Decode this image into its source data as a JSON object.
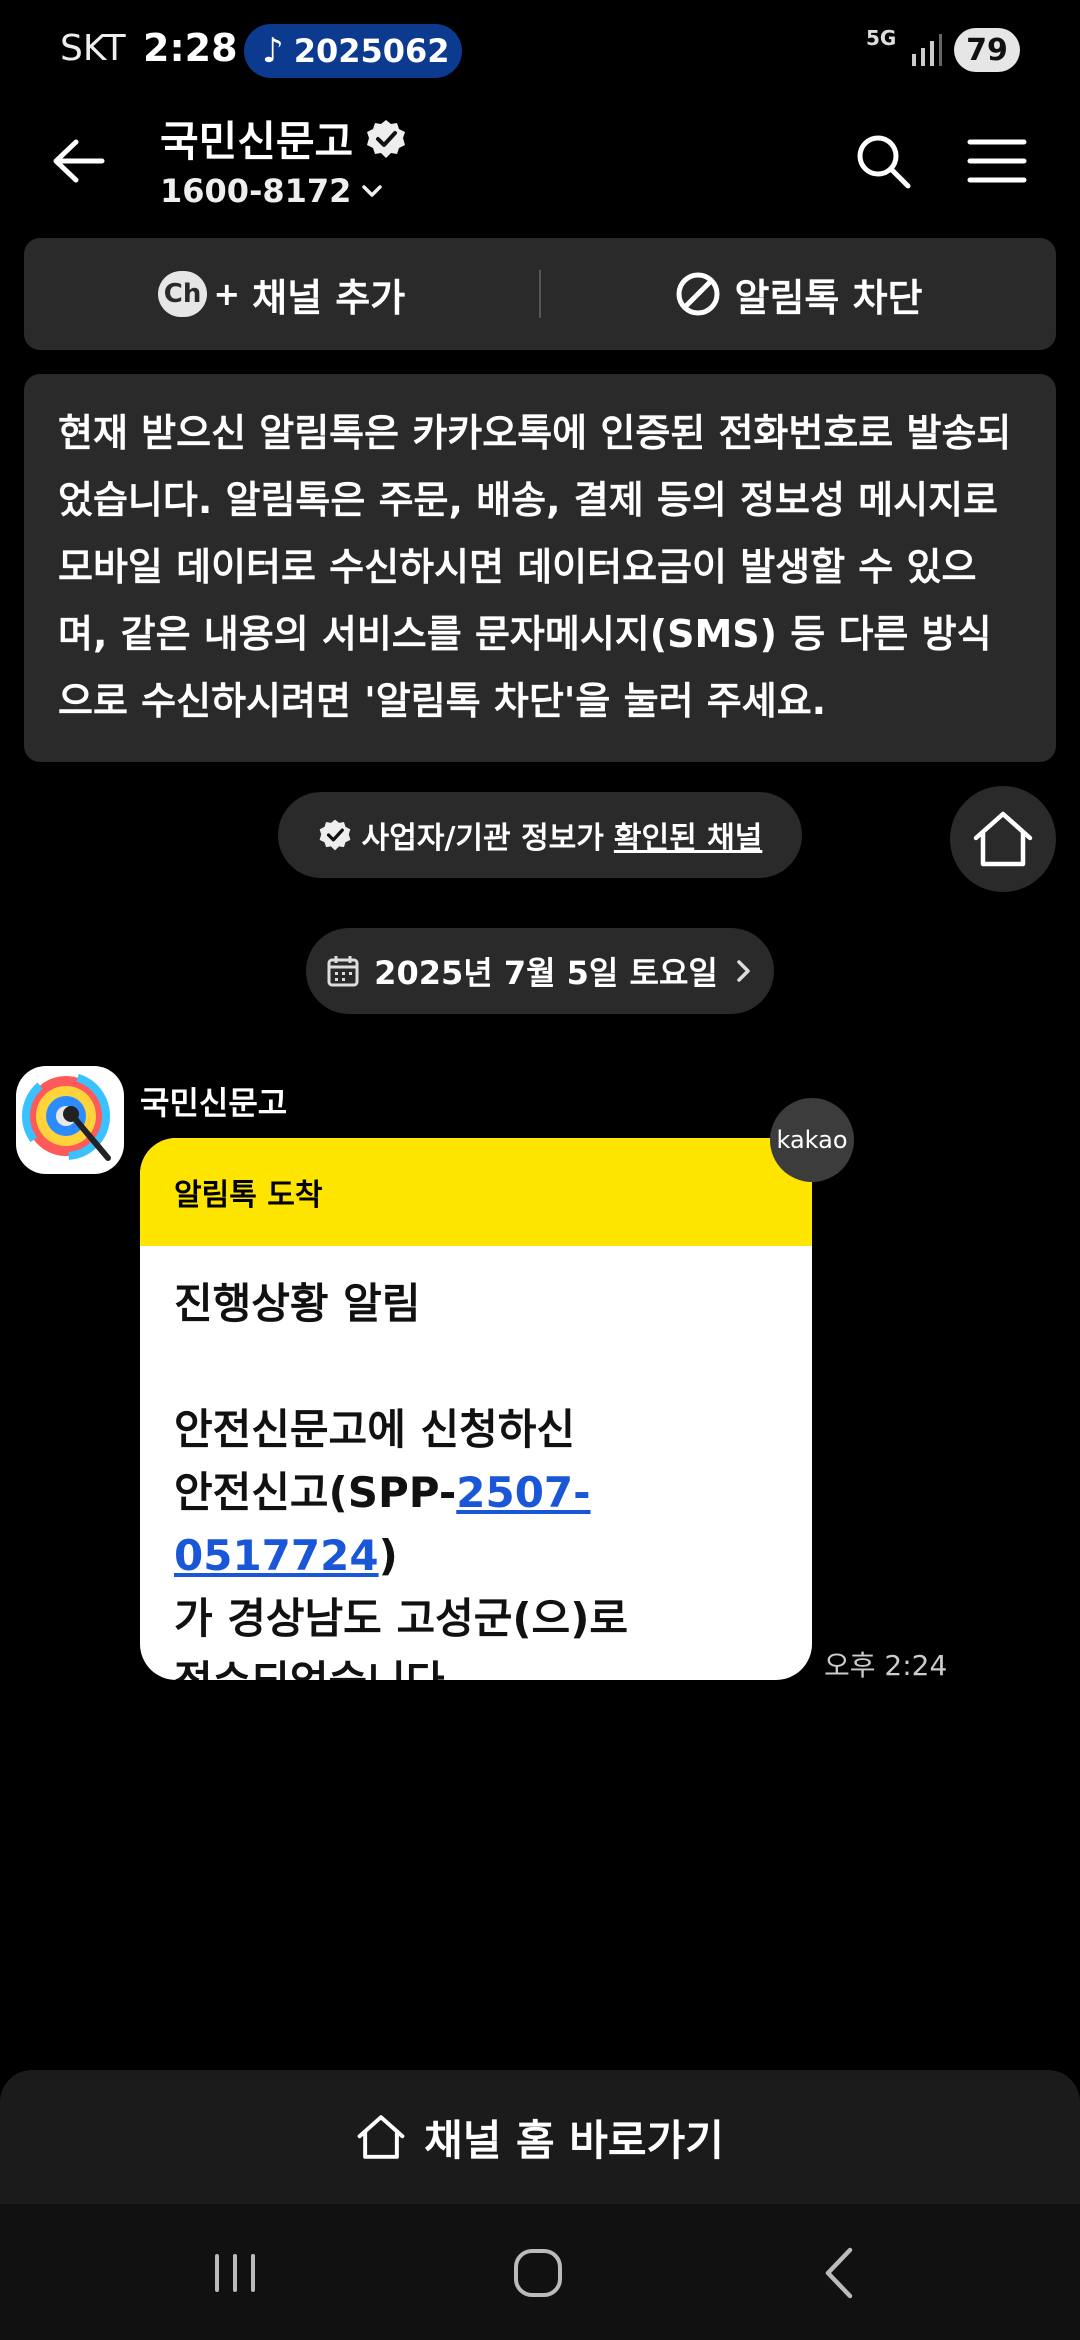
{
  "status_bar": {
    "carrier": "SKT",
    "time": "2:28",
    "music_text": "2025062",
    "network": "5G",
    "battery": "79"
  },
  "header": {
    "title": "국민신문고",
    "phone": "1600-8172"
  },
  "actions": {
    "add_channel": "채널 추가",
    "block": "알림톡 차단",
    "ch_icon_text": "Ch"
  },
  "notice": {
    "text": "현재 받으신 알림톡은 카카오톡에 인증된 전화번호로 발송되었습니다. 알림톡은 주문, 배송, 결제 등의 정보성 메시지로 모바일 데이터로 수신하시면 데이터요금이 발생할 수 있으며, 같은 내용의 서비스를 문자메시지(SMS) 등 다른 방식으로 수신하시려면 '알림톡 차단'을 눌러 주세요."
  },
  "verified": {
    "prefix": "사업자/기관 정보가",
    "link": "확인된 채널"
  },
  "date_divider": "2025년 7월 5일 토요일",
  "message": {
    "sender": "국민신문고",
    "kakao_badge": "kakao",
    "header_label": "알림톡 도착",
    "title": "진행상황 알림",
    "line1": "안전신문고에 신청하신",
    "line2_prefix": "안전신고(SPP-",
    "line2_number": "2507-0517724",
    "line2_suffix": ")",
    "line3": "가 경상남도 고성군(으)로",
    "line4": "접수되었습니다.",
    "time": "오후 2:24"
  },
  "bottom": {
    "home_shortcut": "채널 홈 바로가기"
  },
  "colors": {
    "background": "#000000",
    "card_header": "#fee500",
    "link": "#1a57d8",
    "surface": "#2a2a2a"
  }
}
